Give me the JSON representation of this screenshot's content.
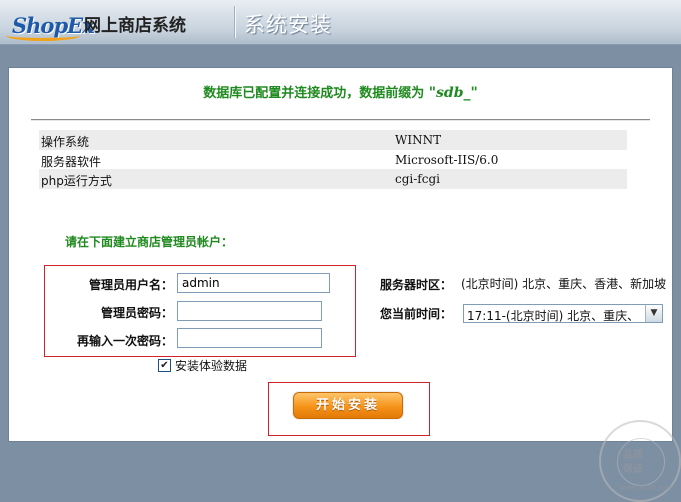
{
  "header": {
    "logo_text": "ShopEx",
    "app_title": "网上商店系统",
    "section_title": "系统安装"
  },
  "status": {
    "message": "数据库已配置并连接成功，数据前缀为",
    "prefix": "\"sdb_\""
  },
  "environment": [
    {
      "key": "操作系统",
      "value": "WINNT"
    },
    {
      "key": "服务器软件",
      "value": "Microsoft-IIS/6.0"
    },
    {
      "key": "php运行方式",
      "value": "cgi-fcgi"
    }
  ],
  "admin_form": {
    "heading": "请在下面建立商店管理员帐户：",
    "username_label": "管理员用户名：",
    "username_value": "admin",
    "password_label": "管理员密码：",
    "password_value": "",
    "confirm_label": "再输入一次密码：",
    "confirm_value": ""
  },
  "server": {
    "timezone_label": "服务器时区：",
    "timezone_value": "(北京时间) 北京、重庆、香港、新加坡",
    "time_label": "您当前时间：",
    "time_selected": "17:11-(北京时间) 北京、重庆、"
  },
  "demo_data": {
    "checked": true,
    "label": "安装体验数据"
  },
  "install_button": "开始安装",
  "watermark": {
    "line1": "品质",
    "line2": "保证",
    "url": "www.3A88.com"
  },
  "colors": {
    "accent_green": "#1f8a1f",
    "highlight_red": "#d0222a",
    "button_orange": "#f6931a"
  }
}
